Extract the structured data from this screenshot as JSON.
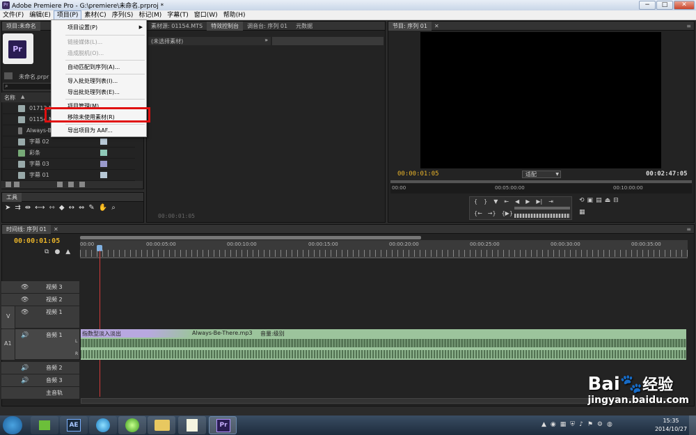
{
  "window": {
    "title": "Adobe Premiere Pro - G:\\premiere\\未命名.prproj *",
    "min": "−",
    "max": "□",
    "close": "✕"
  },
  "menubar": [
    {
      "label": "文件(F)"
    },
    {
      "label": "编辑(E)"
    },
    {
      "label": "项目(P)",
      "active": true
    },
    {
      "label": "素材(C)"
    },
    {
      "label": "序列(S)"
    },
    {
      "label": "标记(M)"
    },
    {
      "label": "字幕(T)"
    },
    {
      "label": "窗口(W)"
    },
    {
      "label": "帮助(H)"
    }
  ],
  "project_menu": {
    "items": [
      {
        "label": "项目设置(P)",
        "has_submenu": true,
        "disabled": false
      },
      {
        "label": "链接媒体(L)...",
        "disabled": true
      },
      {
        "label": "造成脱机(O)...",
        "disabled": true
      },
      {
        "label": "自动匹配到序列(A)...",
        "disabled": false
      },
      {
        "label": "导入批处理列表(I)...",
        "disabled": false
      },
      {
        "label": "导出批处理列表(E)...",
        "disabled": false
      },
      {
        "label": "项目管理(M)...",
        "disabled": false
      },
      {
        "label": "移除未使用素材(R)",
        "disabled": false,
        "highlighted": true
      },
      {
        "label": "导出项目为 AAF...",
        "disabled": false
      }
    ]
  },
  "project_panel": {
    "tab": "项目:未命名",
    "project_file": "未命名.prpr",
    "column_name": "名称",
    "items": [
      {
        "name": "01712.M",
        "color": "#8fb8c9"
      },
      {
        "name": "01154.M",
        "color": "#8fb8c9"
      },
      {
        "name": "Always-Be",
        "color": "#8fc9a8"
      },
      {
        "name": "字幕 02",
        "color": "#b8c9d6"
      },
      {
        "name": "彩条",
        "color": "#8fc9b8"
      },
      {
        "name": "字幕 03",
        "color": "#9a9acc"
      },
      {
        "name": "字幕 01",
        "color": "#b8c9d6"
      }
    ]
  },
  "tools_panel": {
    "tab": "工具"
  },
  "source_panel": {
    "tabs": [
      "素材源: 01154.MTS",
      "特效控制台",
      "调音台: 序列 01",
      "元数据"
    ],
    "active_tab": 1,
    "header": "(未选择素材)",
    "timecode": "00:00:01:05"
  },
  "program_panel": {
    "tab": "节目: 序列 01",
    "current_timecode": "00:00:01:05",
    "fit": "适配",
    "duration": "00:02:47:05",
    "ruler": [
      "00:00",
      "00:05:00:00",
      "00:10:00:00"
    ]
  },
  "timeline": {
    "tab": "时间线: 序列 01",
    "timecode": "00:00:01:05",
    "ruler": [
      "00:00",
      "00:00:05:00",
      "00:00:10:00",
      "00:00:15:00",
      "00:00:20:00",
      "00:00:25:00",
      "00:00:30:00",
      "00:00:35:00"
    ],
    "video_tracks": [
      "视频 3",
      "视频 2",
      "视频 1"
    ],
    "audio_tracks": [
      "音频 1",
      "音频 2",
      "音频 3",
      "主音轨"
    ],
    "v_label": "V",
    "a_label": "A1",
    "transition_label": "指数型淡入淡出",
    "clip_label": "Always-Be-There.mp3",
    "volume_label": "音量:级别",
    "channel_l": "L",
    "channel_r": "R"
  },
  "taskbar": {
    "time": "15:35",
    "date": "2014/10/27",
    "apps": [
      "windows-start",
      "nvidia",
      "after-effects",
      "media-player",
      "browser-360",
      "file-explorer",
      "notepad",
      "premiere"
    ],
    "ae_label": "AE",
    "pr_label": "Pr"
  },
  "watermark": {
    "brand": "Bai",
    "brand_cn": "经验",
    "url": "jingyan.baidu.com"
  }
}
